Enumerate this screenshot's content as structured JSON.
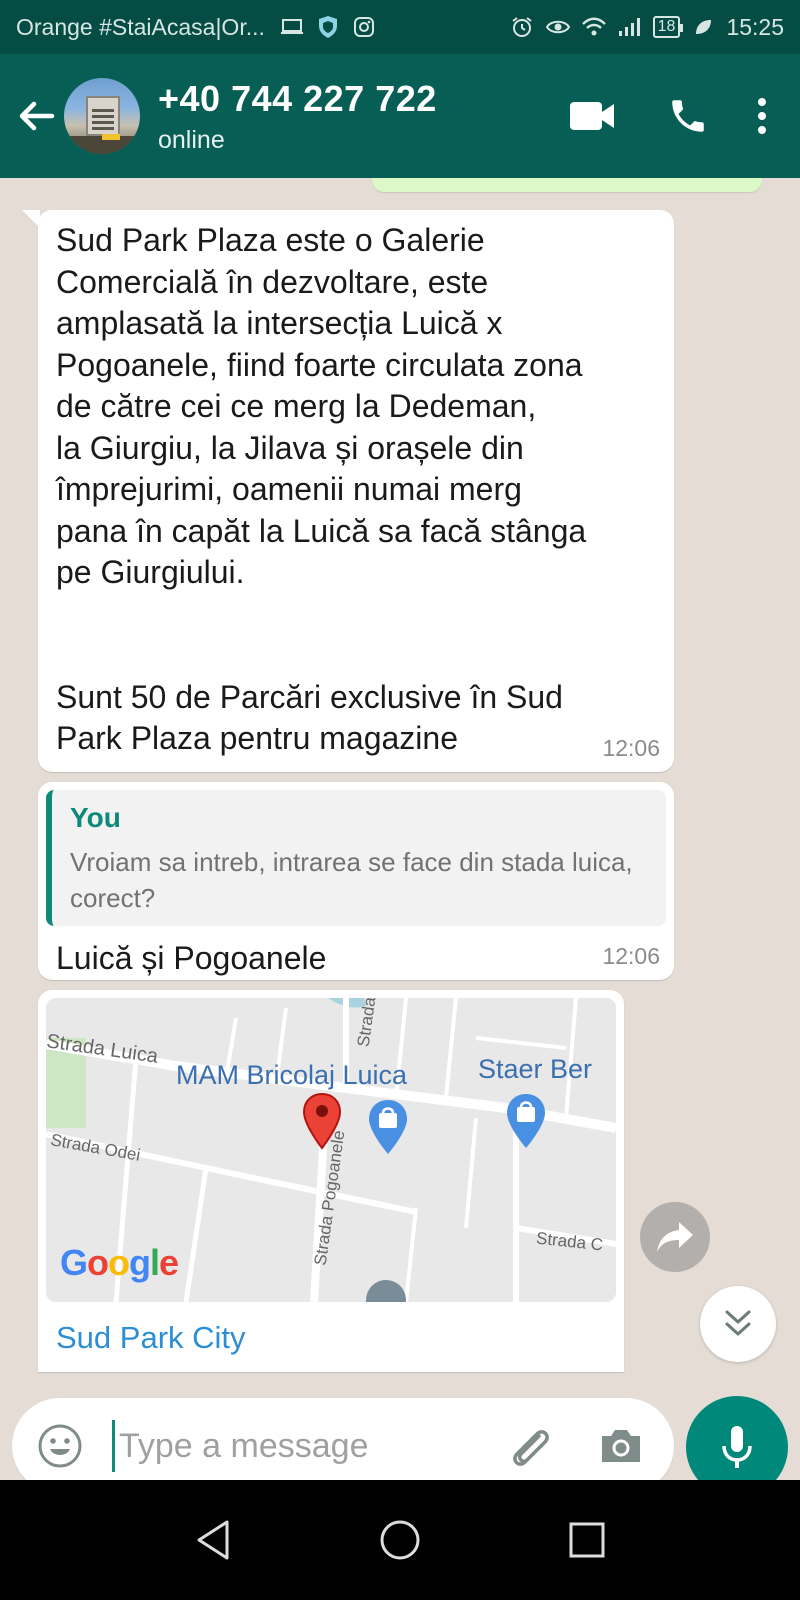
{
  "status_bar": {
    "carrier": "Orange #StaiAcasa|Or...",
    "battery": "18",
    "time": "15:25"
  },
  "header": {
    "contact_name": "+40 744 227 722",
    "contact_status": "online"
  },
  "messages": [
    {
      "text": "Sud Park Plaza este o Galerie\nComercială în dezvoltare, este\namplasată la intersecția Luică x\nPogoanele, fiind foarte circulata zona\nde către cei ce merg la Dedeman,\nla Giurgiu, la Jilava și orașele din\nîmprejurimi, oamenii numai merg\npana în capăt la Luică sa facă stânga\npe Giurgiului.\n\n\nSunt 50 de Parcări exclusive în Sud\nPark Plaza pentru magazine",
      "time": "12:06"
    },
    {
      "quote_author": "You",
      "quote_text": "Vroiam sa intreb, intrarea se face din stada luica, corect?",
      "text": "Luică și Pogoanele",
      "time": "12:06"
    },
    {
      "map": {
        "labels": {
          "mam": "MAM Bricolaj Luica",
          "staer": "Staer Ber",
          "strada_luica": "Strada Luica",
          "strada_odei": "Strada Odei",
          "strada_pogoanele": "Strada Pogoanele",
          "strada_top": "Strada",
          "strada_right": "Strada C"
        },
        "google": {
          "g": "G",
          "o1": "o",
          "o2": "o",
          "g2": "g",
          "l": "l",
          "e": "e"
        }
      },
      "place_name": "Sud Park City"
    }
  ],
  "input": {
    "placeholder": "Type a message"
  },
  "colors": {
    "header": "#075e54",
    "status_bar": "#054d44",
    "accent": "#00897b",
    "chat_bg": "#e5ddd5",
    "link": "#2c8fd6"
  },
  "icons": [
    "back-arrow-icon",
    "video-call-icon",
    "phone-icon",
    "more-vert-icon",
    "forward-icon",
    "double-chevron-down-icon",
    "emoji-icon",
    "attach-icon",
    "camera-icon",
    "mic-icon",
    "nav-back-icon",
    "nav-home-icon",
    "nav-recents-icon"
  ]
}
